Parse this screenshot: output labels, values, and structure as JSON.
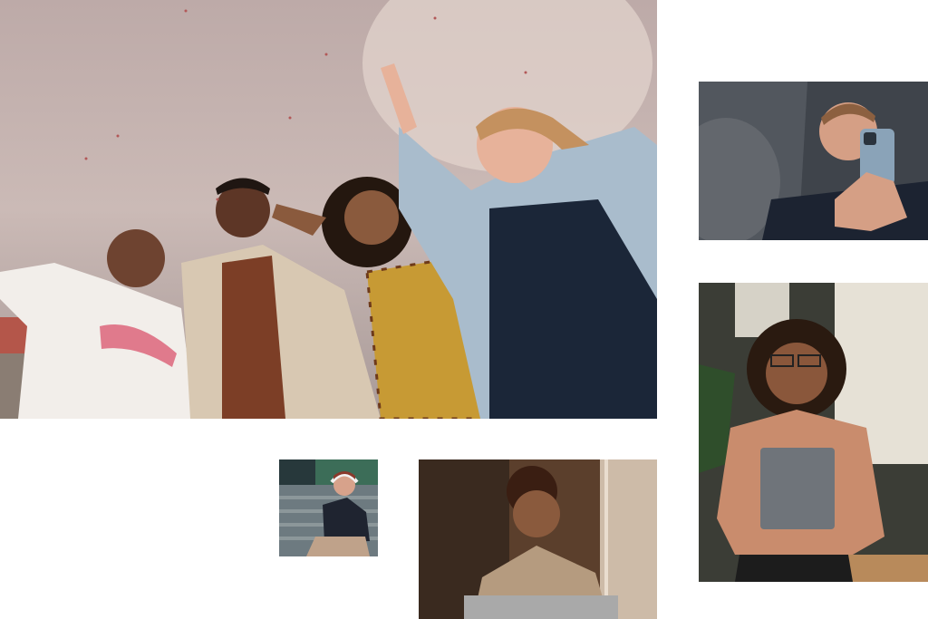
{
  "photos": [
    {
      "id": "hero",
      "subject": "group-celebrating-outdoors"
    },
    {
      "id": "phone-man",
      "subject": "man-smiling-at-phone"
    },
    {
      "id": "laptop-woman",
      "subject": "woman-holding-laptop"
    },
    {
      "id": "headphones-woman",
      "subject": "woman-with-headphones-on-steps"
    },
    {
      "id": "window-woman",
      "subject": "woman-by-window"
    }
  ],
  "colors": {
    "sky": "#c9b7b4",
    "skin_dark": "#7a4a33",
    "skin_light": "#e0ad90",
    "denim": "#a9bccc",
    "plaid": "#c79a34",
    "shirt_peach": "#c98c6d",
    "background": "#ffffff"
  }
}
